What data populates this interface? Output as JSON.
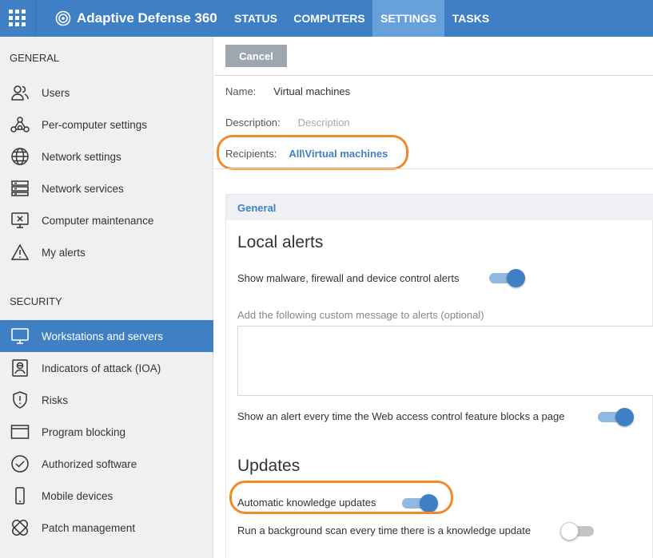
{
  "topnav": {
    "brand": "Adaptive Defense 360",
    "tabs": [
      {
        "label": "STATUS"
      },
      {
        "label": "COMPUTERS"
      },
      {
        "label": "SETTINGS",
        "active": true
      },
      {
        "label": "TASKS"
      }
    ]
  },
  "sidebar": {
    "general_title": "GENERAL",
    "general_items": [
      {
        "label": "Users",
        "icon": "users-icon"
      },
      {
        "label": "Per-computer settings",
        "icon": "network-nodes-icon"
      },
      {
        "label": "Network settings",
        "icon": "globe-icon"
      },
      {
        "label": "Network services",
        "icon": "server-icon"
      },
      {
        "label": "Computer maintenance",
        "icon": "monitor-x-icon"
      },
      {
        "label": "My alerts",
        "icon": "warning-icon"
      }
    ],
    "security_title": "SECURITY",
    "security_items": [
      {
        "label": "Workstations and servers",
        "icon": "monitor-icon",
        "active": true
      },
      {
        "label": "Indicators of attack (IOA)",
        "icon": "attacker-icon"
      },
      {
        "label": "Risks",
        "icon": "shield-alert-icon"
      },
      {
        "label": "Program blocking",
        "icon": "window-icon"
      },
      {
        "label": "Authorized software",
        "icon": "check-circle-icon"
      },
      {
        "label": "Mobile devices",
        "icon": "phone-icon"
      },
      {
        "label": "Patch management",
        "icon": "patch-icon"
      }
    ]
  },
  "form": {
    "cancel_label": "Cancel",
    "name_label": "Name:",
    "name_value": "Virtual machines",
    "description_label": "Description:",
    "description_placeholder": "Description",
    "recipients_label": "Recipients:",
    "recipients_value": "All\\Virtual machines"
  },
  "panel": {
    "header": "General",
    "local_alerts_title": "Local alerts",
    "show_alerts_label": "Show malware, firewall and device control alerts",
    "show_alerts_on": true,
    "custom_message_label": "Add the following custom message to alerts (optional)",
    "custom_message_value": "",
    "web_alert_label": "Show an alert every time the Web access control feature blocks a page",
    "web_alert_on": true,
    "updates_title": "Updates",
    "auto_updates_label": "Automatic knowledge updates",
    "auto_updates_on": true,
    "bg_scan_label": "Run a background scan every time there is a knowledge update",
    "bg_scan_on": false
  },
  "colors": {
    "accent": "#3f80c4",
    "highlight": "#f08a2c"
  }
}
